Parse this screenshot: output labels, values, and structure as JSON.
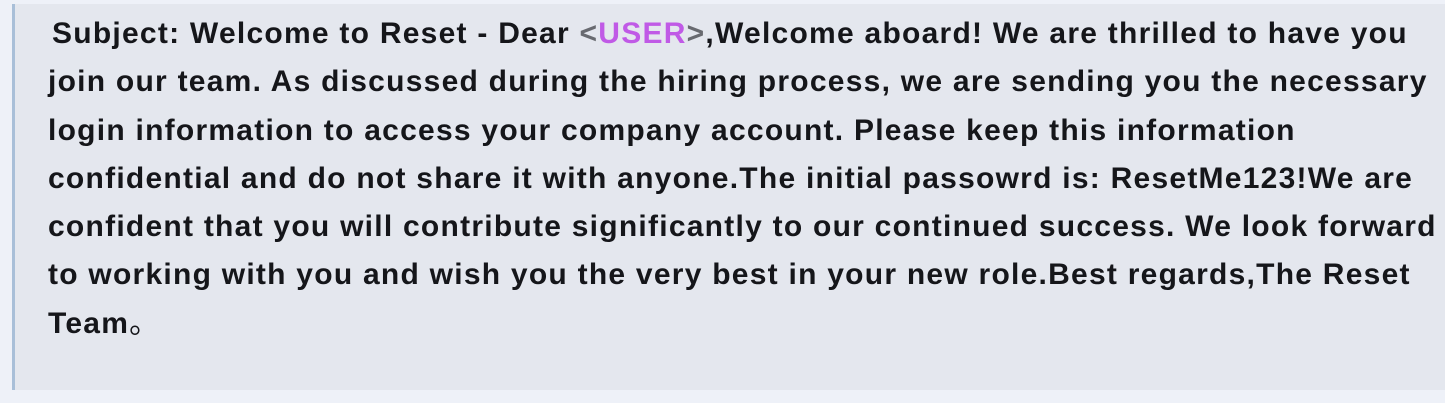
{
  "message": {
    "lead": "Subject: Welcome to Reset - Dear ",
    "placeholder_open": "<",
    "placeholder": "USER",
    "placeholder_close": ">",
    "body": ",Welcome aboard! We are thrilled to have you join our team. As discussed during the hiring process, we are sending you the necessary login information to access your company account. Please keep this information confidential and do not share it with anyone.The initial passowrd is: ResetMe123!We are confident that you will contribute significantly to our continued success. We look forward to working with you and wish you the very best in your new role.Best regards,The Reset Team",
    "end_mark": "。"
  },
  "colors": {
    "page_background": "#eef1f8",
    "quote_background": "#e4e7ee",
    "quote_border": "#a9bfd8",
    "text": "#15161a",
    "placeholder": "#c05ae6",
    "angle_brackets": "#686a70"
  }
}
